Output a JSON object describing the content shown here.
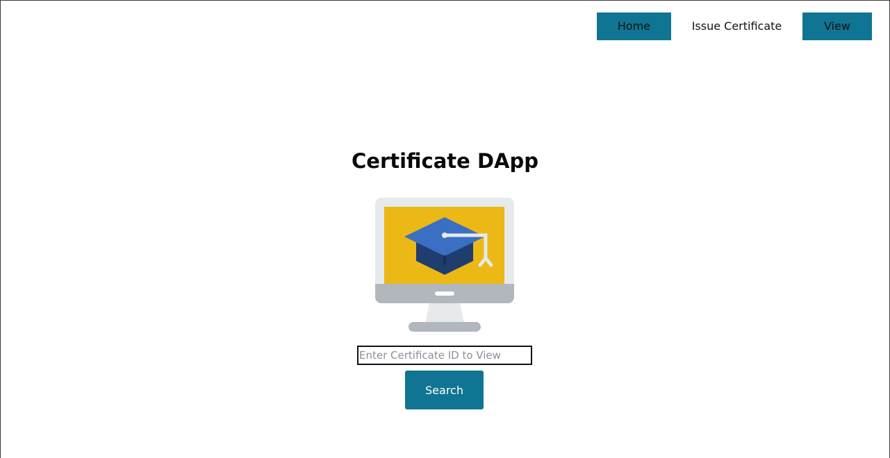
{
  "nav": {
    "home_label": "Home",
    "issue_label": "Issue Certificate",
    "view_label": "View"
  },
  "main": {
    "title": "Certificate DApp",
    "illustration_icon": "graduation-cap-monitor-icon",
    "search_placeholder": "Enter Certificate ID to View",
    "search_value": "",
    "search_button_label": "Search"
  },
  "colors": {
    "accent": "#0f7592",
    "screen_background": "#ebb815",
    "cap_blue": "#3a6fc4",
    "cap_dark": "#1f3d6e",
    "monitor_frame": "#e6eaea",
    "monitor_base": "#b2b7bd"
  }
}
